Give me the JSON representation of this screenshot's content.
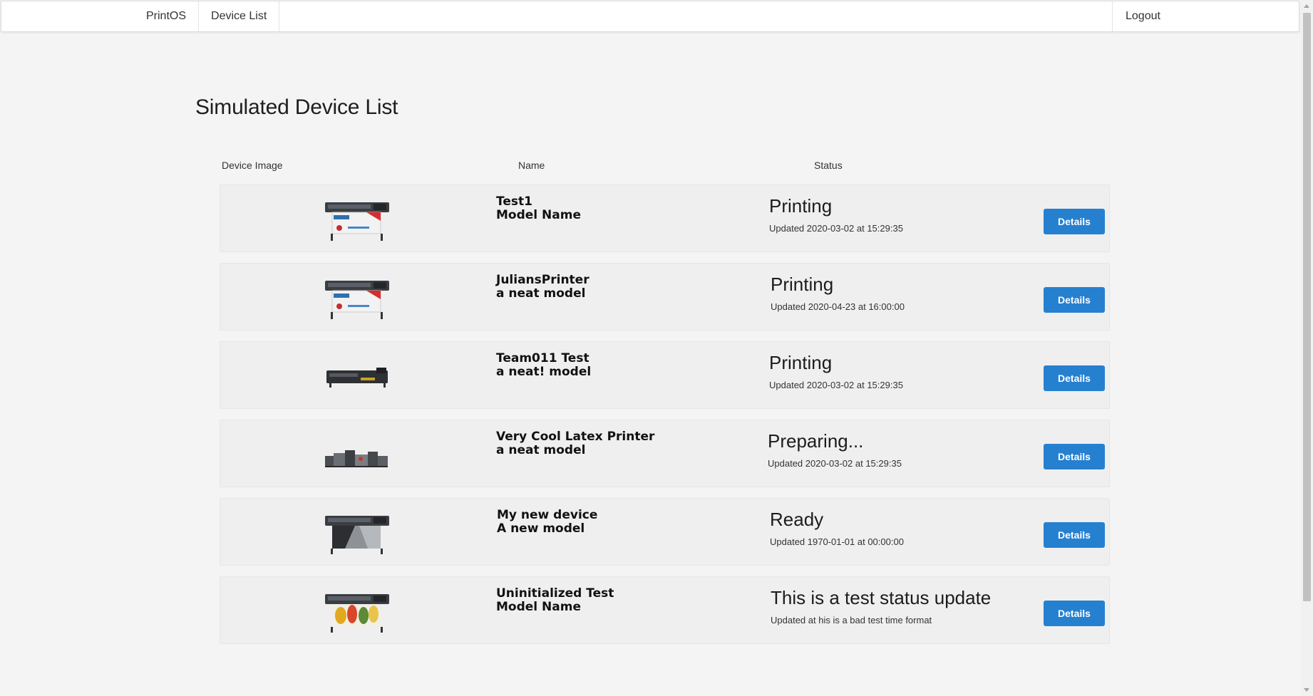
{
  "nav": {
    "brand": "PrintOS",
    "device_list": "Device List",
    "logout": "Logout"
  },
  "page_title": "Simulated Device List",
  "columns": {
    "image": "Device Image",
    "name": "Name",
    "status": "Status"
  },
  "details_label": "Details",
  "devices": [
    {
      "name": "Test1",
      "model": "Model Name",
      "status": "Printing",
      "updated": "Updated 2020-03-02 at 15:29:35",
      "image_icon": "wide-format-printer-banner-icon"
    },
    {
      "name": "JuliansPrinter",
      "model": "a neat model",
      "status": "Printing",
      "updated": "Updated 2020-04-23 at 16:00:00",
      "image_icon": "wide-format-printer-banner-icon"
    },
    {
      "name": "Team011 Test",
      "model": "a neat! model",
      "status": "Printing",
      "updated": "Updated 2020-03-02 at 15:29:35",
      "image_icon": "industrial-printer-icon"
    },
    {
      "name": "Very Cool Latex Printer",
      "model": "a neat model",
      "status": "Preparing...",
      "updated": "Updated 2020-03-02 at 15:29:35",
      "image_icon": "press-line-icon"
    },
    {
      "name": "My new device",
      "model": "A new model",
      "status": "Ready",
      "updated": "Updated 1970-01-01 at 00:00:00",
      "image_icon": "large-format-printer-icon"
    },
    {
      "name": "Uninitialized Test",
      "model": "Model Name",
      "status": "This is a test status update",
      "updated": "Updated at his is a bad test time format",
      "image_icon": "color-printer-icon"
    }
  ]
}
